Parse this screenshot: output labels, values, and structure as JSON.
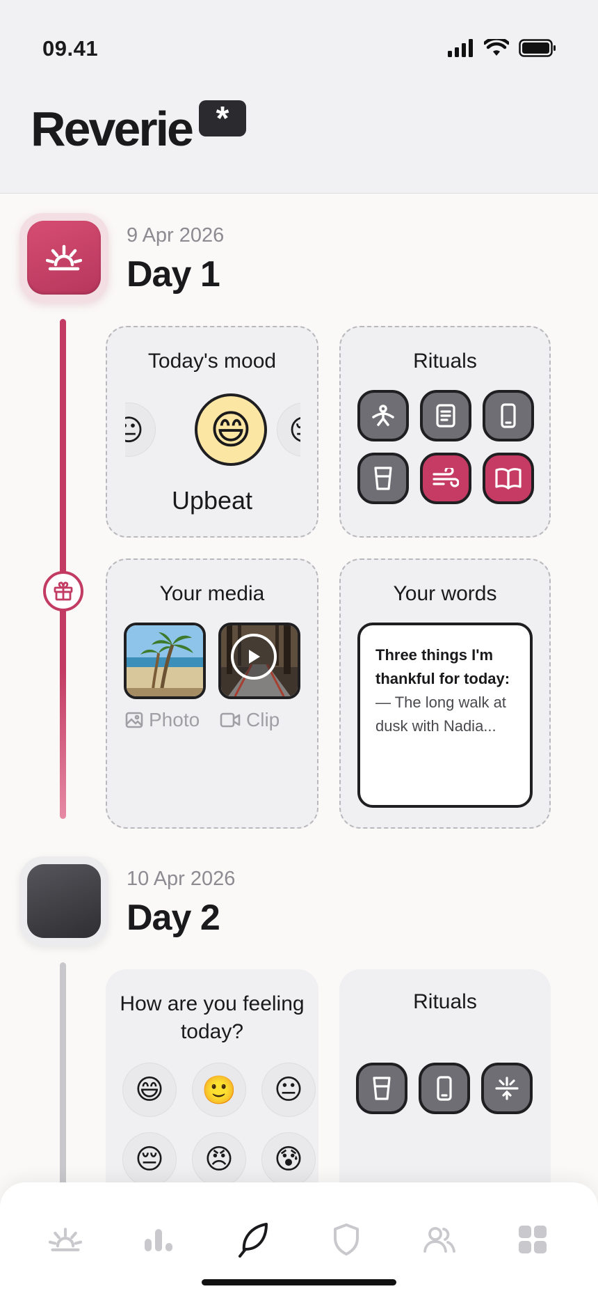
{
  "status_bar": {
    "time": "09.41"
  },
  "header": {
    "app_name": "Reverie",
    "badge": "*"
  },
  "day1": {
    "date": "9 Apr 2026",
    "title": "Day 1",
    "mood_card": {
      "title": "Today's mood",
      "emojis": [
        "😐",
        "😄",
        "😔"
      ],
      "selected": "😄",
      "label": "Upbeat"
    },
    "rituals_card": {
      "title": "Rituals",
      "items": [
        {
          "icon": "stretch-icon",
          "active": false
        },
        {
          "icon": "journal-icon",
          "active": false
        },
        {
          "icon": "phone-icon",
          "active": false
        },
        {
          "icon": "water-glass-icon",
          "active": false
        },
        {
          "icon": "breathing-icon",
          "active": true
        },
        {
          "icon": "book-icon",
          "active": true
        }
      ]
    },
    "media_card": {
      "title": "Your media",
      "photo_label": "Photo",
      "clip_label": "Clip"
    },
    "words_card": {
      "title": "Your words",
      "heading": "Three things I'm thankful for today:",
      "body": "— The long walk at dusk with Nadia..."
    }
  },
  "day2": {
    "date": "10 Apr 2026",
    "title": "Day 2",
    "mood_card": {
      "title": "How are you feeling today?",
      "emojis": [
        "😄",
        "🙂",
        "😐",
        "😔",
        "😠",
        "😰"
      ]
    },
    "rituals_card": {
      "title": "Rituals",
      "items": [
        {
          "icon": "water-glass-icon",
          "active": false
        },
        {
          "icon": "phone-icon",
          "active": false
        },
        {
          "icon": "sleep-icon",
          "active": false
        }
      ]
    }
  },
  "tabbar": {
    "items": [
      "sunrise-tab",
      "stats-tab",
      "journal-tab",
      "shield-tab",
      "people-tab",
      "grid-tab"
    ],
    "active": "journal-tab"
  },
  "colors": {
    "accent": "#c53b63",
    "dark": "#1f1f22",
    "muted": "#8c8b91"
  }
}
